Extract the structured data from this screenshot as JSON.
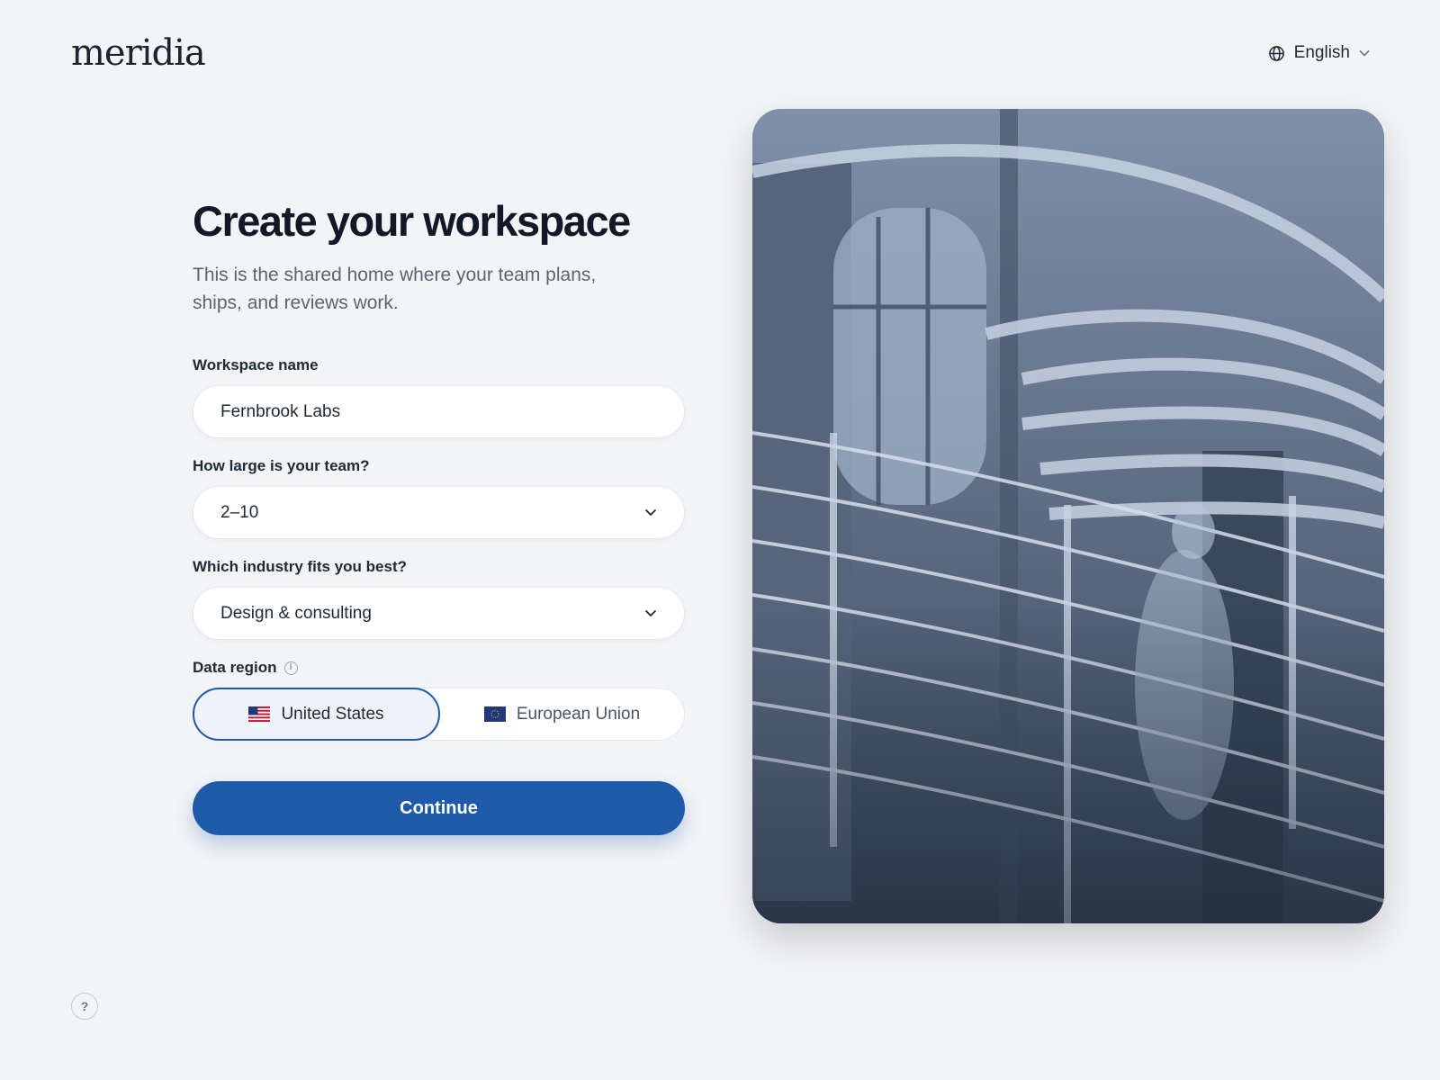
{
  "brand": {
    "name": "meridia"
  },
  "language": {
    "label": "English",
    "icon": "globe-icon"
  },
  "form": {
    "title": "Create your workspace",
    "subtitle": "This is the shared home where your team plans, ships, and reviews work.",
    "workspace_name": {
      "label": "Workspace name",
      "value": "Fernbrook Labs"
    },
    "team_size": {
      "label": "How large is your team?",
      "selected": "2–10"
    },
    "industry": {
      "label": "Which industry fits you best?",
      "selected": "Design & consulting"
    },
    "data_region": {
      "label": "Data region",
      "options": [
        {
          "label": "United States",
          "selected": true,
          "icon": "us-flag-icon"
        },
        {
          "label": "European Union",
          "selected": false,
          "icon": "eu-flag-icon"
        }
      ]
    },
    "continue_label": "Continue"
  },
  "help": {
    "label": "?"
  },
  "colors": {
    "accent": "#1e5aa8",
    "background": "#f3f4f6",
    "selected_bg": "#eef3fa"
  }
}
